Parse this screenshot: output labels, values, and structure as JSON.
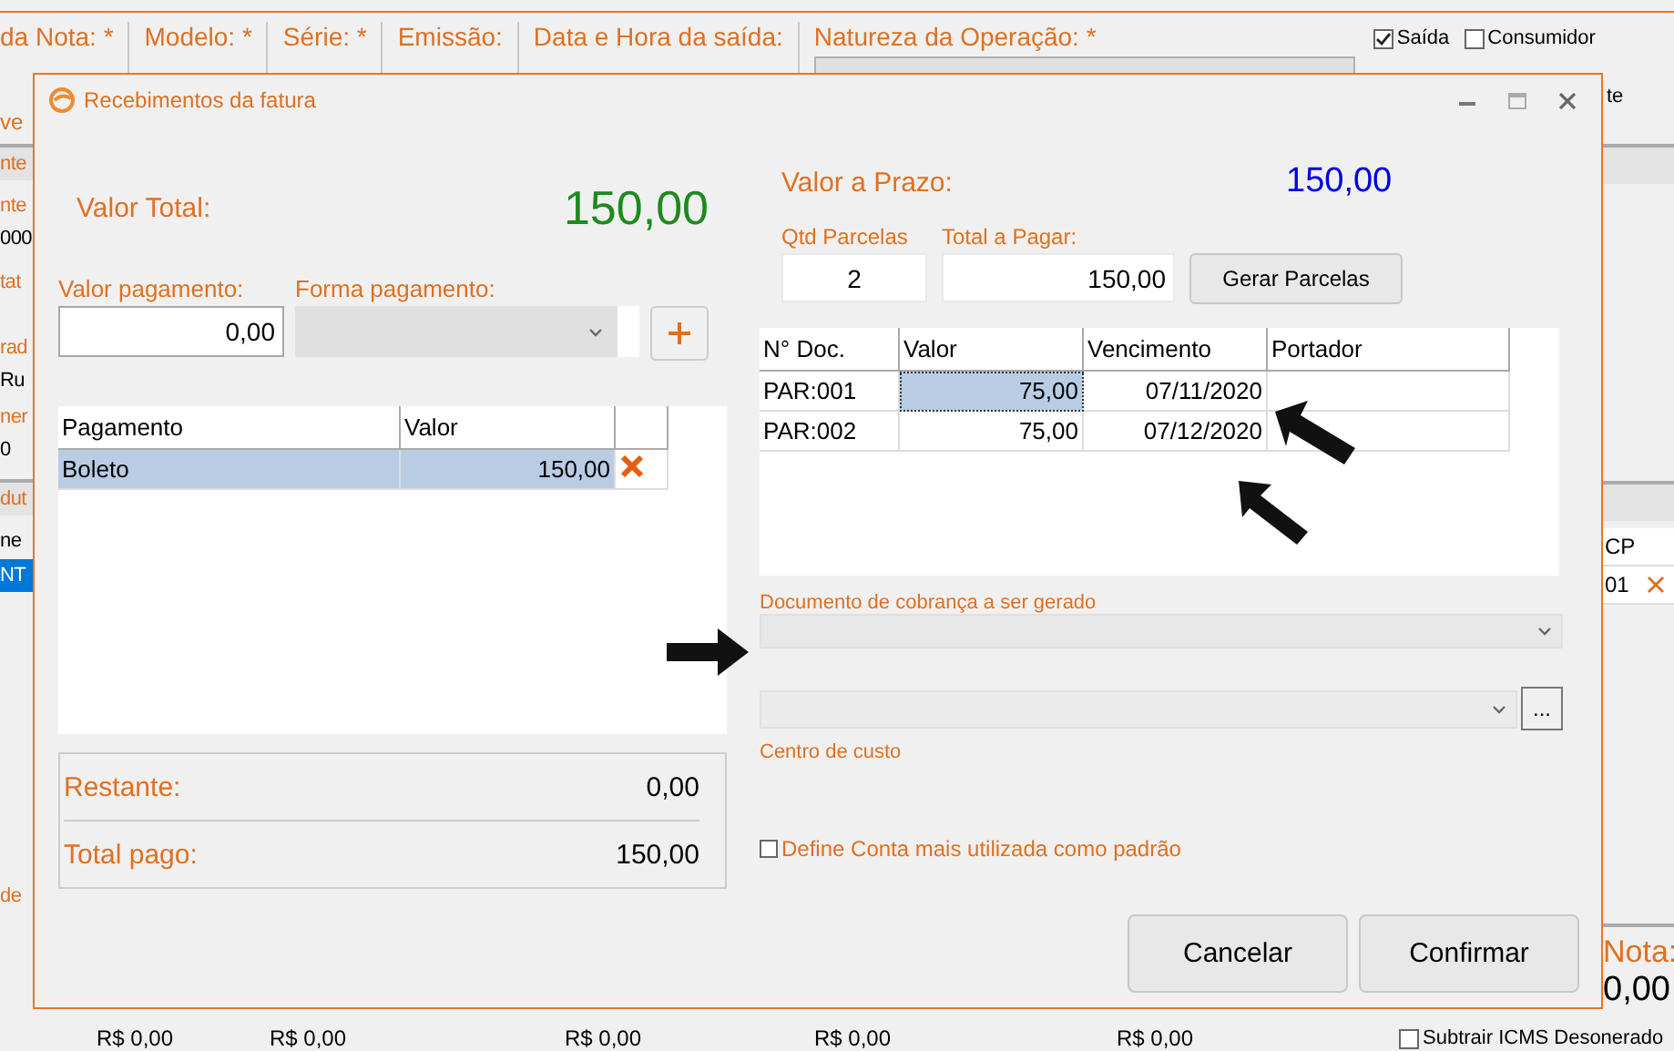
{
  "background": {
    "header_fields": [
      {
        "label": "da Nota: *",
        "kind": "text"
      },
      {
        "label": "Modelo: *",
        "kind": "text"
      },
      {
        "label": "Série: *",
        "kind": "text"
      },
      {
        "label": "Emissão:",
        "kind": "text"
      },
      {
        "label": "Data e Hora da saída:",
        "kind": "text"
      },
      {
        "label": "Natureza da Operação: *",
        "kind": "combo"
      }
    ],
    "note_fragment": "ve",
    "options": [
      {
        "label": "Saída",
        "checked": true
      },
      {
        "label": "Consumidor",
        "checked": false
      }
    ],
    "option_fragment": "te",
    "left_strip": [
      {
        "text": "nte",
        "kind": "band"
      },
      {
        "text": "nte",
        "kind": "label"
      },
      {
        "text": "000",
        "kind": "value"
      },
      {
        "text": "tat",
        "kind": "label"
      },
      {
        "text": "rad",
        "kind": "label"
      },
      {
        "text": "Ru",
        "kind": "value"
      },
      {
        "text": "ner",
        "kind": "label"
      },
      {
        "text": "0",
        "kind": "value"
      },
      {
        "text": "dut",
        "kind": "band"
      },
      {
        "text": "ne",
        "kind": "value"
      },
      {
        "text": "NT",
        "kind": "selected"
      },
      {
        "text": "de",
        "kind": "label"
      }
    ],
    "right_column": {
      "header": "CP",
      "value": "01"
    },
    "nota": {
      "label": "Nota:",
      "value": "0,00"
    },
    "totals": [
      "R$ 0,00",
      "R$ 0,00",
      "R$ 0,00",
      "R$ 0,00",
      "R$ 0,00"
    ],
    "subtrair": {
      "label": "Subtrair ICMS Desonerado",
      "checked": false
    }
  },
  "dialog": {
    "title": "Recebimentos da fatura",
    "valor_total": {
      "label": "Valor Total:",
      "value": "150,00"
    },
    "valor_pagamento": {
      "label": "Valor pagamento:",
      "value": "0,00"
    },
    "forma_pagamento": {
      "label": "Forma pagamento:",
      "disabled": true
    },
    "payments": {
      "columns": [
        "Pagamento",
        "Valor"
      ],
      "rows": [
        {
          "pagamento": "Boleto",
          "valor": "150,00",
          "selected": true
        }
      ]
    },
    "summary": [
      {
        "label": "Restante:",
        "value": "0,00"
      },
      {
        "label": "Total pago:",
        "value": "150,00"
      }
    ],
    "valor_prazo": {
      "label": "Valor a Prazo:",
      "value": "150,00"
    },
    "qtd_parcelas": {
      "label": "Qtd Parcelas",
      "value": "2"
    },
    "total_pagar": {
      "label": "Total a Pagar:",
      "value": "150,00"
    },
    "gerar_button": "Gerar Parcelas",
    "installments": {
      "columns": [
        "N° Doc.",
        "Valor",
        "Vencimento",
        "Portador"
      ],
      "rows": [
        {
          "doc": "PAR:001",
          "valor": "75,00",
          "vencimento": "07/11/2020",
          "selected": true
        },
        {
          "doc": "PAR:002",
          "valor": "75,00",
          "vencimento": "07/12/2020",
          "selected": false
        }
      ]
    },
    "documento": {
      "label": "Documento de cobrança a ser gerado"
    },
    "centro_custo": {
      "label": "Centro de custo"
    },
    "browse_button": "...",
    "default_checkbox": {
      "label": "Define Conta mais utilizada como padrão",
      "checked": false
    },
    "buttons": [
      "Cancelar",
      "Confirmar"
    ]
  }
}
